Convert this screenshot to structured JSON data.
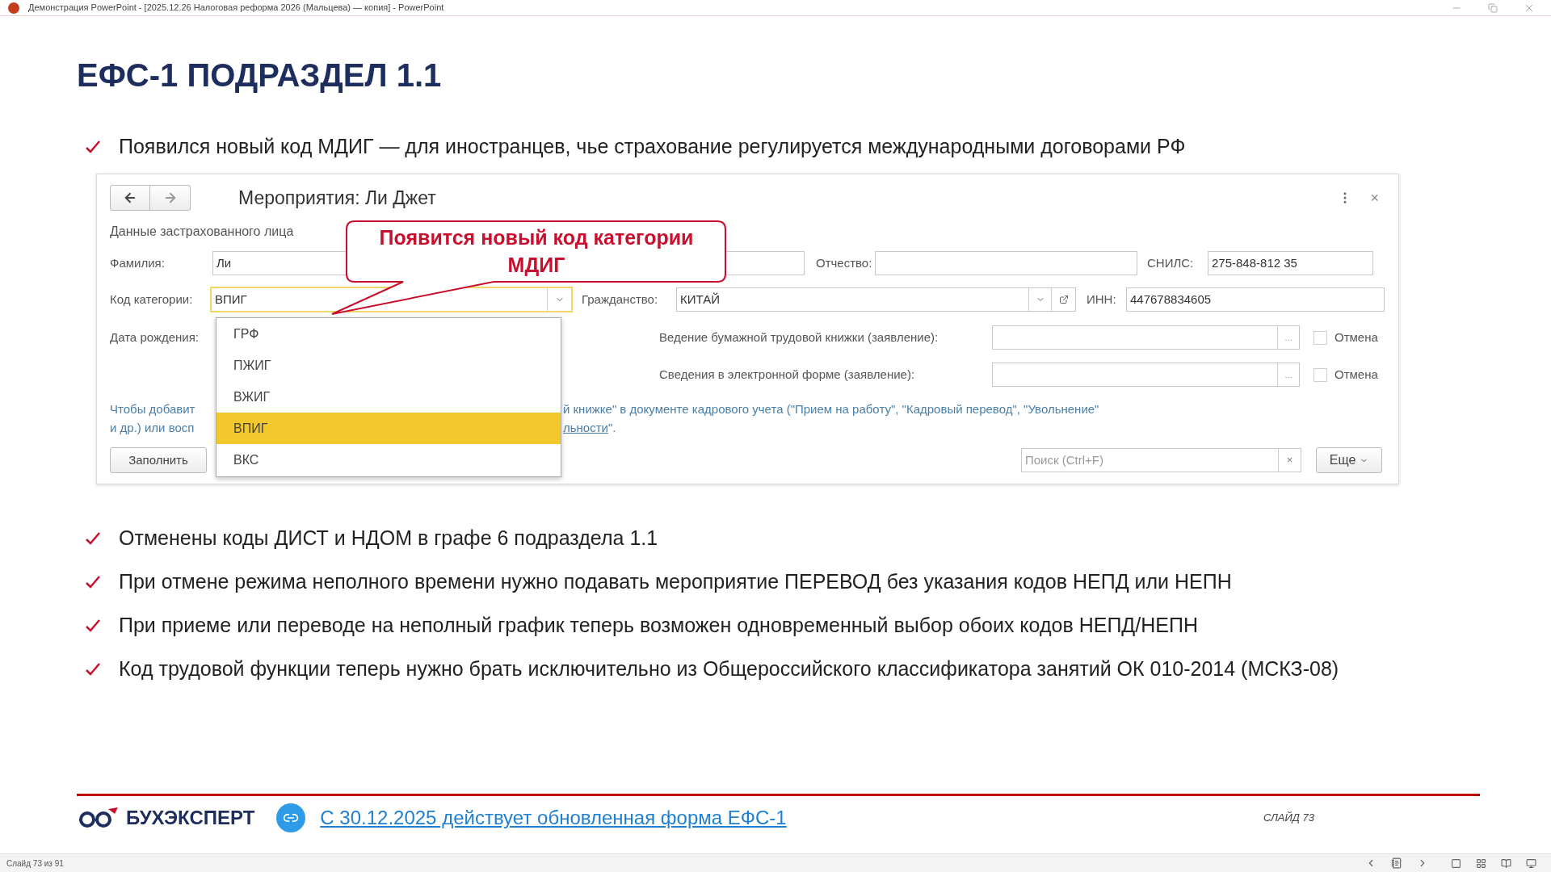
{
  "window": {
    "title": "Демонстрация PowerPoint - [2025.12.26 Налоговая реформа 2026 (Мальцева) — копия] - PowerPoint"
  },
  "slide": {
    "title": "ЕФС-1 ПОДРАЗДЕЛ 1.1",
    "intro_bullet": "Появился новый код МДИГ — для иностранцев, чье страхование регулируется международными договорами РФ",
    "bullets": [
      "Отменены коды ДИСТ и НДОМ в графе 6 подраздела 1.1",
      "При отмене режима неполного времени нужно подавать мероприятие ПЕРЕВОД без указания кодов НЕПД или НЕПН",
      "При приеме или переводе на неполный график теперь возможен одновременный выбор обоих кодов НЕПД/НЕПН",
      "Код трудовой функции теперь нужно брать исключительно из Общероссийского классификатора занятий ОК 010-2014 (МСКЗ-08)"
    ],
    "footer": {
      "brand": "БУХЭКСПЕРТ",
      "link": "С 30.12.2025 действует обновленная форма ЕФС-1",
      "slide_label": "СЛАЙД 73"
    }
  },
  "form": {
    "title": "Мероприятия: Ли Джет",
    "section": "Данные застрахованного лица",
    "surname": {
      "label": "Фамилия:",
      "value": "Ли"
    },
    "patronymic": {
      "label": "Отчество:"
    },
    "snils": {
      "label": "СНИЛС:",
      "value": "275-848-812 35"
    },
    "category": {
      "label": "Код категории:",
      "value": "ВПИГ",
      "focused": true
    },
    "citizenship": {
      "label": "Гражданство:",
      "value": "КИТАЙ"
    },
    "inn": {
      "label": "ИНН:",
      "value": "447678834605"
    },
    "birth_date": {
      "label": "Дата рождения:"
    },
    "paper_book": {
      "label": "Ведение бумажной трудовой книжки (заявление):",
      "button": "...",
      "cancel": {
        "label": "Отмена",
        "checked": false
      }
    },
    "electronic": {
      "label": "Сведения в электронной форме (заявление):",
      "button": "...",
      "cancel": {
        "label": "Отмена",
        "checked": false
      }
    },
    "note": {
      "line1_start": "Чтобы добавит",
      "line1_end": "й книжке\" в документе кадрового учета (\"Прием на работу\", \"Кадровый перевод\", \"Увольнение\"",
      "line2_start": "и др.) или восп",
      "line2_link": "льности",
      "line2_end": "\"."
    },
    "fill_button": "Заполнить",
    "search": {
      "placeholder": "Поиск (Ctrl+F)",
      "clear": "×"
    },
    "more_button": "Еще",
    "close": "×"
  },
  "dropdown": {
    "options": [
      {
        "label": "ГРФ",
        "selected": false
      },
      {
        "label": "ПЖИГ",
        "selected": false
      },
      {
        "label": "ВЖИГ",
        "selected": false
      },
      {
        "label": "ВПИГ",
        "selected": true
      },
      {
        "label": "ВКС",
        "selected": false
      }
    ]
  },
  "callout": {
    "lines": [
      "Появится новый код категории",
      "МДИГ"
    ]
  },
  "status_bar": {
    "slide_info": "Слайд 73 из 91"
  }
}
